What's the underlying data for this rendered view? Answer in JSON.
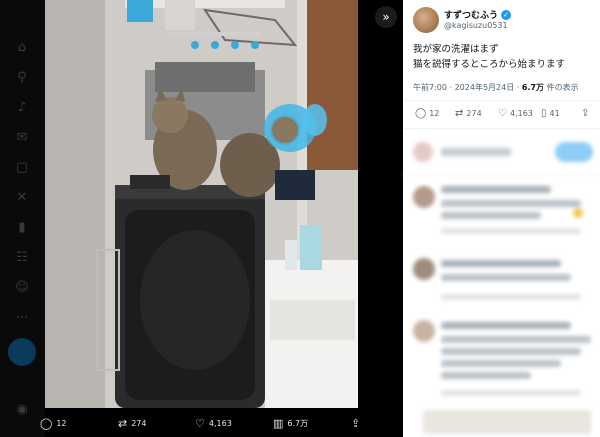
{
  "rail": {
    "icons": [
      "home-icon",
      "explore-icon",
      "notifications-icon",
      "messages-icon",
      "grok-icon",
      "x-logo-icon",
      "bookmarks-icon",
      "communities-icon",
      "profile-icon",
      "more-icon"
    ]
  },
  "viewer": {
    "nav_forward": "»",
    "actions": {
      "replies": "12",
      "reposts": "274",
      "likes": "4,163",
      "views": "6.7万"
    }
  },
  "tweet": {
    "display_name": "すずつむふう",
    "verified": "✓",
    "handle": "@kagisuzu0531",
    "text_line1": "我が家の洗濯はまず",
    "text_line2": "猫を説得するところから始まります",
    "time": "午前7:00 · 2024年5月24日 · ",
    "views_count": "6.7万",
    "views_label": " 件の表示",
    "stats": {
      "replies": "12",
      "reposts": "274",
      "likes": "4,163",
      "bookmarks": "41"
    }
  },
  "colors": {
    "accent": "#1d9bf0",
    "text": "#0f1419",
    "muted": "#536471"
  }
}
